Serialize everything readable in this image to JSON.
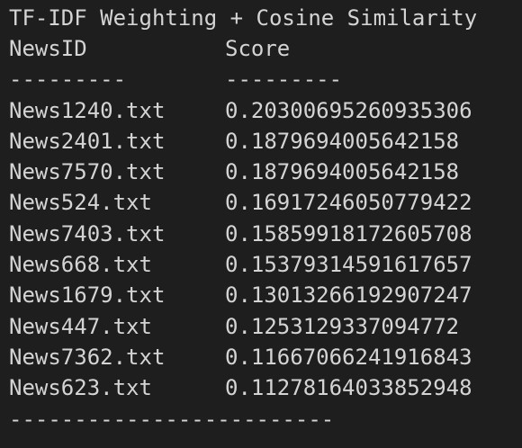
{
  "output": {
    "title": "TF-IDF Weighting + Cosine Similarity",
    "header": {
      "col1": "NewsID",
      "col2": "Score"
    },
    "separator": {
      "col1": "---------",
      "col2": "---------"
    },
    "rows": [
      {
        "id": "News1240.txt",
        "score": "0.20300695260935306"
      },
      {
        "id": "News2401.txt",
        "score": "0.1879694005642158"
      },
      {
        "id": "News7570.txt",
        "score": "0.1879694005642158"
      },
      {
        "id": "News524.txt",
        "score": "0.16917246050779422"
      },
      {
        "id": "News7403.txt",
        "score": "0.15859918172605708"
      },
      {
        "id": "News668.txt",
        "score": "0.15379314591617657"
      },
      {
        "id": "News1679.txt",
        "score": "0.13013266192907247"
      },
      {
        "id": "News447.txt",
        "score": "0.1253129337094772"
      },
      {
        "id": "News7362.txt",
        "score": "0.11667066241916843"
      },
      {
        "id": "News623.txt",
        "score": "0.11278164033852948"
      }
    ],
    "footer": "-------------------------"
  },
  "colors": {
    "background": "#1e1e1e",
    "text": "#d4d4d4"
  }
}
